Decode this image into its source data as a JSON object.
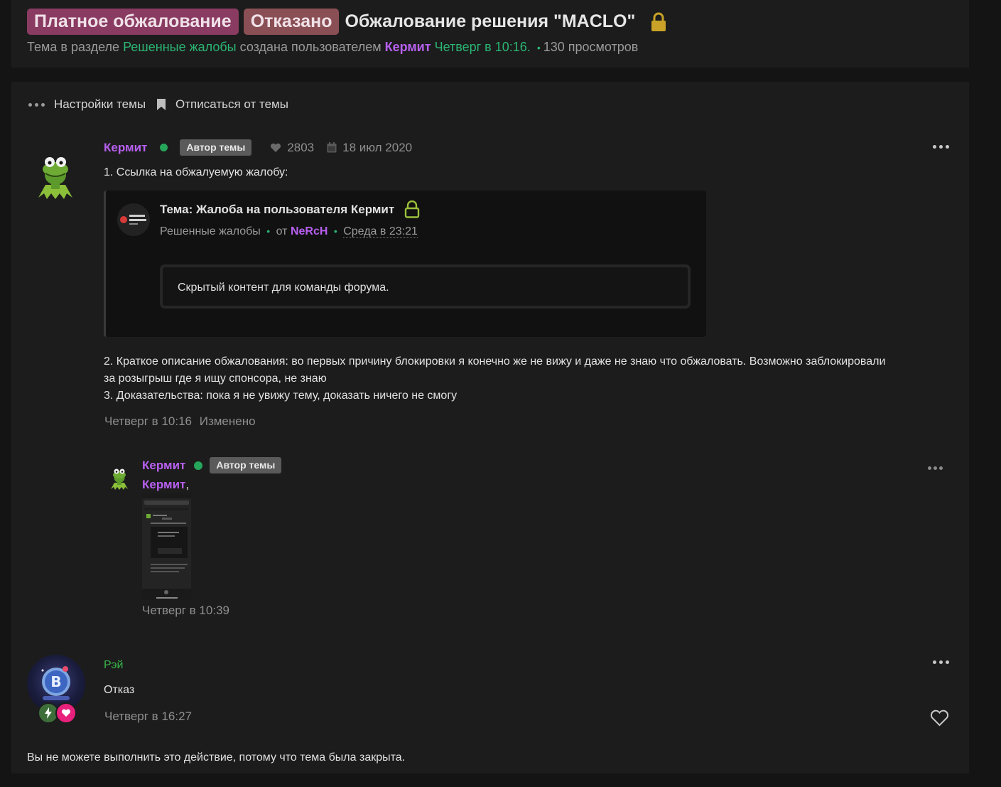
{
  "header": {
    "prefix_paid": "Платное обжалование",
    "prefix_status": "Отказано",
    "title": "Обжалование решения \"MACLO\"",
    "meta_prefix": "Тема в разделе",
    "meta_forum": "Решенные жалобы",
    "meta_created_by": "создана пользователем",
    "meta_author": "Кермит",
    "meta_date": "Четверг в 10:16.",
    "meta_views": "130 просмотров"
  },
  "thread_tools": {
    "settings_label": "Настройки темы",
    "unsubscribe_label": "Отписаться от темы"
  },
  "post1": {
    "username": "Кермит",
    "badge": "Автор темы",
    "likes": "2803",
    "reg_date": "18 июл 2020",
    "line1": "1. Ссылка на обжалуемую жалобу:",
    "quote": {
      "title": "Тема: Жалоба на пользователя Кермит",
      "forum": "Решенные жалобы",
      "by_prefix": "от",
      "by_user": "NeRcH",
      "date": "Среда в 23:21",
      "hidden_text": "Скрытый контент для команды форума."
    },
    "line2": "2. Краткое описание обжалования: во первых причину блокировки я конечно же не вижу и даже не знаю что обжаловать. Возможно заблокировали",
    "line2b": "за розыгрыш где я ищу спонсора, не знаю",
    "line3": "3. Доказательства: пока я не увижу тему, доказать ничего не смогу",
    "footer_date": "Четверг в 10:16",
    "footer_edited": "Изменено"
  },
  "comment1": {
    "username": "Кермит",
    "badge": "Автор темы",
    "mention": "Кермит",
    "mention_suffix": ",",
    "date": "Четверг в 10:39"
  },
  "post2": {
    "username": "Рэй",
    "text": "Отказ",
    "date": "Четверг в 16:27"
  },
  "closed_message": "Вы не можете выполнить это действие, потому что тема была закрыта.",
  "icons": {
    "lock": "lock-icon",
    "more": "more-dots-icon",
    "heart": "heart-icon",
    "calendar": "calendar-icon",
    "bookmark": "bookmark-icon"
  },
  "colors": {
    "username": "#b760f0",
    "forum_link": "#2bb673",
    "rei_name": "#3ab54a",
    "prefix_paid": "#8a3b62",
    "prefix_denied": "#8a4f54"
  }
}
